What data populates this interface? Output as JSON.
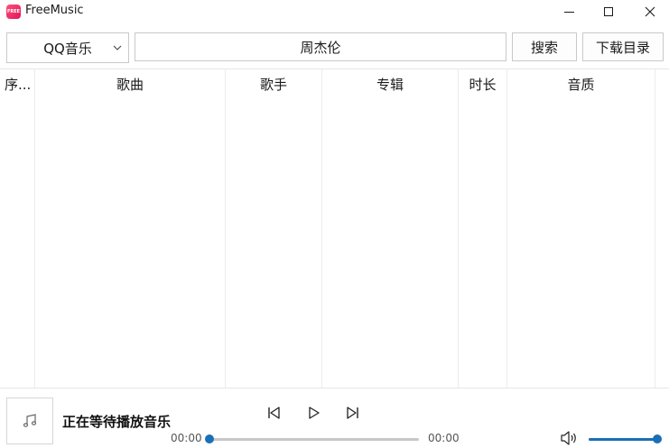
{
  "window": {
    "title": "FreeMusic",
    "logo_text": "FREE",
    "controls": [
      "minimize-icon",
      "maximize-icon",
      "close-icon"
    ]
  },
  "toolbar": {
    "source_selected": "QQ音乐",
    "search_value": "周杰伦",
    "search_label": "搜索",
    "download_dir_label": "下载目录"
  },
  "table": {
    "headers": [
      "序...",
      "歌曲",
      "歌手",
      "专辑",
      "时长",
      "音质"
    ],
    "rows": []
  },
  "player": {
    "status_text": "正在等待播放音乐",
    "current_time": "00:00",
    "total_time": "00:00",
    "progress": 0,
    "volume": 1.0,
    "icons": [
      "music-note-icon",
      "skip-previous-icon",
      "play-icon",
      "skip-next-icon",
      "volume-icon"
    ]
  },
  "colors": {
    "accent": "#1a6fb5",
    "logo": "#e8235e",
    "border": "#c9c9c9"
  }
}
